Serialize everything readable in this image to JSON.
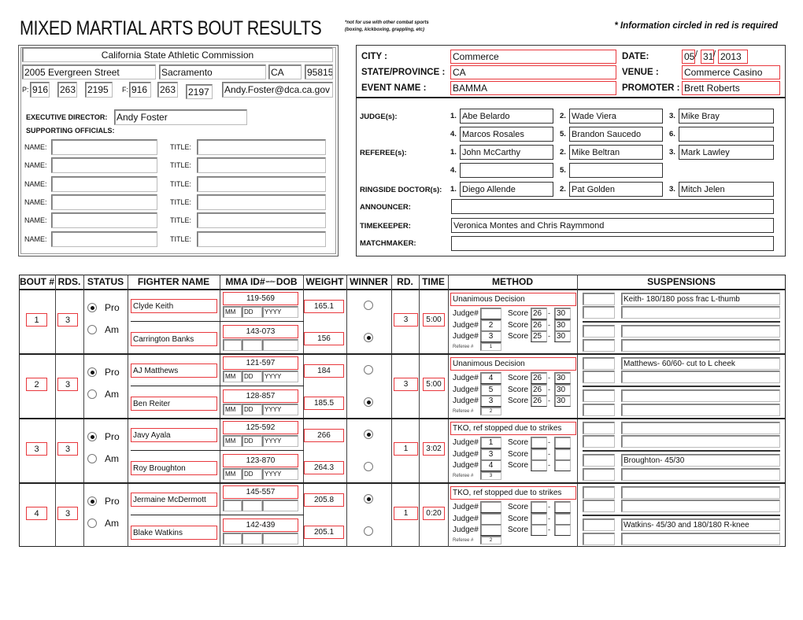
{
  "header": {
    "title": "MIXED MARTIAL ARTS BOUT RESULTS",
    "note_line1": "*not for use with other combat sports",
    "note_line2": "(boxing, kickboxing, grappling, etc)",
    "required_note": "* Information circled in red is required"
  },
  "commission": {
    "name": "California State Athletic Commission",
    "street": "2005 Evergreen Street",
    "city": "Sacramento",
    "state": "CA",
    "zip": "95815",
    "phone_label": "P:",
    "phone": [
      "916",
      "263",
      "2195"
    ],
    "fax_label": "F:",
    "fax": [
      "916",
      "263",
      "2197"
    ],
    "email": "Andy.Foster@dca.ca.gov"
  },
  "officials": {
    "exec_label": "EXECUTIVE DIRECTOR:",
    "exec_value": "Andy Foster",
    "supporting_label": "SUPPORTING OFFICIALS:",
    "name_label": "NAME:",
    "title_label": "TITLE:",
    "rows": [
      {
        "name": "",
        "title": ""
      },
      {
        "name": "",
        "title": ""
      },
      {
        "name": "",
        "title": ""
      },
      {
        "name": "",
        "title": ""
      },
      {
        "name": "",
        "title": ""
      },
      {
        "name": "",
        "title": ""
      }
    ]
  },
  "event": {
    "city_label": "CITY :",
    "city": "Commerce",
    "date_label": "DATE:",
    "date": [
      "05",
      "31",
      "2013"
    ],
    "date_sep": "/",
    "state_label": "STATE/PROVINCE :",
    "state": "CA",
    "venue_label": "VENUE :",
    "venue": "Commerce Casino",
    "event_label": "EVENT NAME :",
    "event_name": "BAMMA",
    "promoter_label": "PROMOTER :",
    "promoter": "Brett Roberts"
  },
  "staff": {
    "judges_label": "JUDGE(s):",
    "judges": [
      "Abe Belardo",
      "Wade Viera",
      "Mike Bray",
      "Marcos Rosales",
      "Brandon Saucedo",
      ""
    ],
    "referees_label": "REFEREE(s):",
    "referees": [
      "John McCarthy",
      "Mike Beltran",
      "Mark Lawley",
      "",
      ""
    ],
    "doctors_label": "RINGSIDE DOCTOR(s):",
    "doctors": [
      "Diego Allende",
      "Pat Golden",
      "Mitch Jelen"
    ],
    "announcer_label": "ANNOUNCER:",
    "announcer": "",
    "timekeeper_label": "TIMEKEEPER:",
    "timekeeper": "Veronica Montes and Chris Raymmond",
    "matchmaker_label": "MATCHMAKER:",
    "matchmaker": ""
  },
  "table": {
    "headers": [
      "BOUT #",
      "RDS.",
      "STATUS",
      "FIGHTER NAME",
      "MMA ID#",
      "and/or",
      "DOB",
      "WEIGHT",
      "WINNER",
      "RD.",
      "TIME",
      "METHOD",
      "SUSPENSIONS"
    ],
    "pro_label": "Pro",
    "am_label": "Am",
    "judge_label": "Judge#",
    "score_label": "Score",
    "score_sep": "-",
    "referee_label": "Referee #",
    "bouts": [
      {
        "bout": "1",
        "rds": "3",
        "status": "Pro",
        "rd": "3",
        "time": "5:00",
        "method": "Unanimous Decision",
        "winner": 2,
        "referee": "1",
        "fighters": [
          {
            "name": "Clyde Keith",
            "id": "119-569",
            "dob": [
              "MM",
              "DD",
              "YYYY"
            ],
            "weight": "165.1"
          },
          {
            "name": "Carrington Banks",
            "id": "143-073",
            "dob": [
              "",
              "",
              ""
            ],
            "weight": "156"
          }
        ],
        "judges": [
          {
            "j": "",
            "s1": "26",
            "s2": "30"
          },
          {
            "j": "2",
            "s1": "26",
            "s2": "30"
          },
          {
            "j": "3",
            "s1": "25",
            "s2": "30"
          }
        ],
        "suspensions": [
          {
            "a": "",
            "b": "Keith- 180/180 poss frac L-thumb"
          },
          {
            "a": "",
            "b": ""
          },
          {
            "a": "",
            "b": ""
          },
          {
            "a": "",
            "b": ""
          }
        ]
      },
      {
        "bout": "2",
        "rds": "3",
        "status": "Pro",
        "rd": "3",
        "time": "5:00",
        "method": "Unanimous Decision",
        "winner": 2,
        "referee": "2",
        "fighters": [
          {
            "name": "AJ Matthews",
            "id": "121-597",
            "dob": [
              "MM",
              "DD",
              "YYYY"
            ],
            "weight": "184"
          },
          {
            "name": "Ben Reiter",
            "id": "128-857",
            "dob": [
              "MM",
              "DD",
              "YYYY"
            ],
            "weight": "185.5"
          }
        ],
        "judges": [
          {
            "j": "4",
            "s1": "26",
            "s2": "30"
          },
          {
            "j": "5",
            "s1": "26",
            "s2": "30"
          },
          {
            "j": "3",
            "s1": "26",
            "s2": "30"
          }
        ],
        "suspensions": [
          {
            "a": "",
            "b": "Matthews- 60/60- cut to L cheek"
          },
          {
            "a": "",
            "b": ""
          },
          {
            "a": "",
            "b": ""
          },
          {
            "a": "",
            "b": ""
          }
        ]
      },
      {
        "bout": "3",
        "rds": "3",
        "status": "Pro",
        "rd": "1",
        "time": "3:02",
        "method": "TKO, ref stopped due to strikes",
        "winner": 1,
        "referee": "3",
        "fighters": [
          {
            "name": "Javy Ayala",
            "id": "125-592",
            "dob": [
              "MM",
              "DD",
              "YYYY"
            ],
            "weight": "266"
          },
          {
            "name": "Roy Broughton",
            "id": "123-870",
            "dob": [
              "MM",
              "DD",
              "YYYY"
            ],
            "weight": "264.3"
          }
        ],
        "judges": [
          {
            "j": "1",
            "s1": "",
            "s2": ""
          },
          {
            "j": "3",
            "s1": "",
            "s2": ""
          },
          {
            "j": "4",
            "s1": "",
            "s2": ""
          }
        ],
        "suspensions": [
          {
            "a": "",
            "b": ""
          },
          {
            "a": "",
            "b": ""
          },
          {
            "a": "",
            "b": "Broughton- 45/30"
          },
          {
            "a": "",
            "b": ""
          }
        ]
      },
      {
        "bout": "4",
        "rds": "3",
        "status": "Pro",
        "rd": "1",
        "time": "0:20",
        "method": "TKO, ref stopped due to strikes",
        "winner": 1,
        "referee": "2",
        "fighters": [
          {
            "name": "Jermaine McDermott",
            "id": "145-557",
            "dob": [
              "",
              "",
              ""
            ],
            "weight": "205.8"
          },
          {
            "name": "Blake Watkins",
            "id": "142-439",
            "dob": [
              "",
              "",
              ""
            ],
            "weight": "205.1"
          }
        ],
        "judges": [
          {
            "j": "",
            "s1": "",
            "s2": ""
          },
          {
            "j": "",
            "s1": "",
            "s2": ""
          },
          {
            "j": "",
            "s1": "",
            "s2": ""
          }
        ],
        "suspensions": [
          {
            "a": "",
            "b": ""
          },
          {
            "a": "",
            "b": ""
          },
          {
            "a": "",
            "b": "Watkins- 45/30 and 180/180 R-knee"
          },
          {
            "a": "",
            "b": ""
          }
        ]
      }
    ]
  },
  "colors": {
    "required_outline": "#e8383d",
    "border": "#222222"
  }
}
